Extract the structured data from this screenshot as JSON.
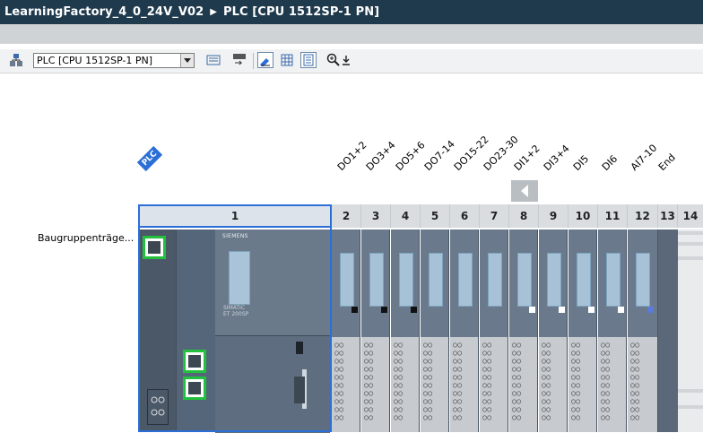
{
  "title_bar": {
    "project": "LearningFactory_4_0_24V_V02",
    "device": "PLC [CPU 1512SP-1 PN]"
  },
  "toolbar": {
    "device_select_value": "PLC [CPU 1512SP-1 PN]"
  },
  "canvas": {
    "plc_tag": "PLC",
    "rack_label": "Baugruppenträge...",
    "module_labels": [
      "DO1+2",
      "DO3+4",
      "DO5+6",
      "DO7-14",
      "DO15-22",
      "DO23-30",
      "DI1+2",
      "DI3+4",
      "DI5",
      "DI6",
      "AI7-10",
      "End"
    ],
    "slots": [
      "1",
      "2",
      "3",
      "4",
      "5",
      "6",
      "7",
      "8",
      "9",
      "10",
      "11",
      "12",
      "13",
      "14"
    ],
    "cpu_texts": {
      "brand": "SIEMENS",
      "line1": "SIMATIC",
      "line2": "ET 200SP"
    }
  },
  "colors": {
    "titlebar": "#1f3a4d",
    "selection": "#2b6fd6",
    "port_highlight": "#22c03c"
  }
}
